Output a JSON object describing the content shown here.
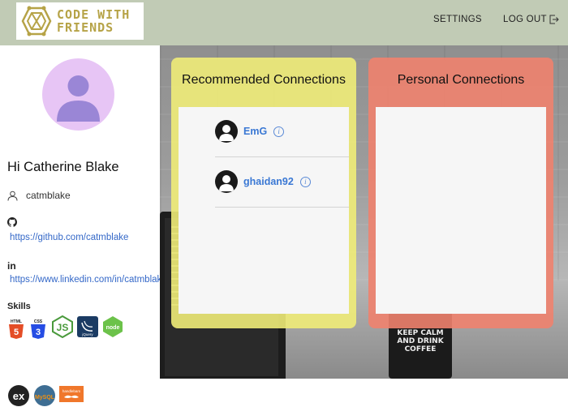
{
  "header": {
    "logo_line1": "CODE WITH",
    "logo_line2": "FRIENDS",
    "settings_label": "SETTINGS",
    "logout_label": "LOG OUT"
  },
  "sidebar": {
    "greeting": "Hi Catherine Blake",
    "username": "catmblake",
    "github_url": "https://github.com/catmblake",
    "linkedin_label": "in",
    "linkedin_url": "https://www.linkedin.com/in/catmblake",
    "skills_label": "Skills",
    "skills": [
      "html5-icon",
      "css3-icon",
      "javascript-icon",
      "jquery-icon",
      "nodejs-icon",
      "express-icon",
      "mysql-icon",
      "handlebars-icon"
    ]
  },
  "recommended": {
    "title": "Recommended Connections",
    "users": [
      {
        "name": "EmG"
      },
      {
        "name": "ghaidan92"
      }
    ]
  },
  "personal": {
    "title": "Personal Connections"
  },
  "background": {
    "mug_text": "KEEP CALM AND DRINK COFFEE"
  },
  "colors": {
    "header_bg": "#c1cbb5",
    "logo_gold": "#b6a347",
    "link_blue": "#3468c8",
    "recommended_panel": "#f0ec78",
    "personal_panel": "#f0826e",
    "avatar_bg": "#e7c5f5"
  }
}
